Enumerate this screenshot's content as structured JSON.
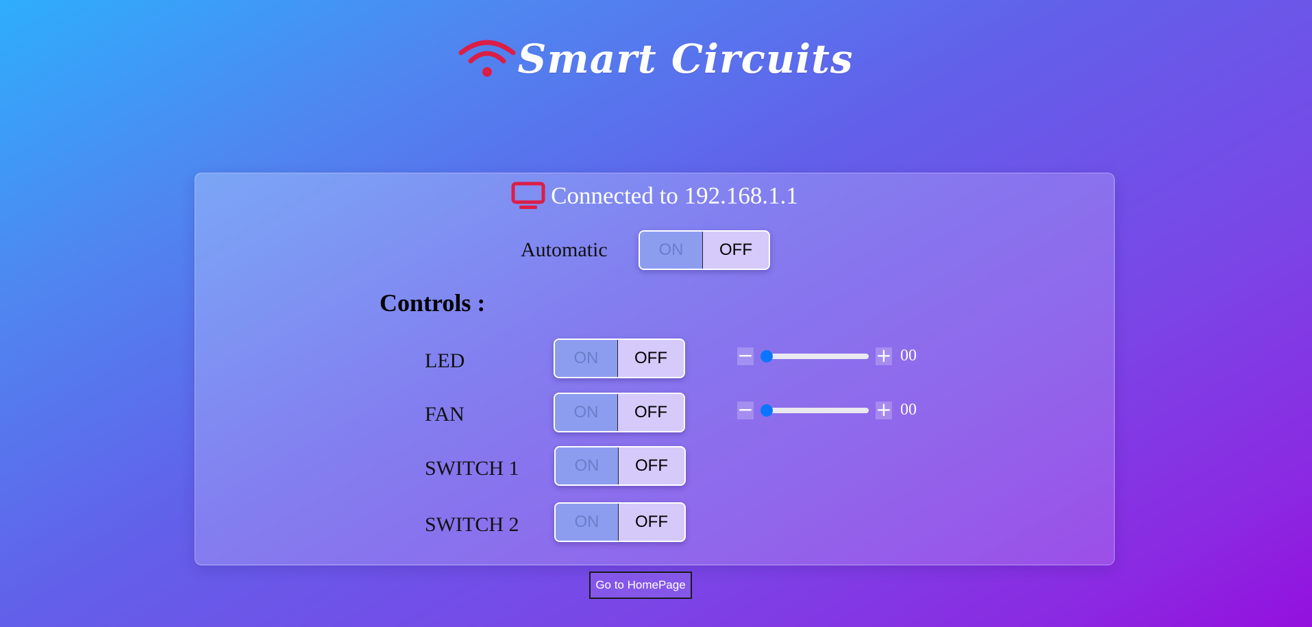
{
  "header": {
    "brand": "Smart Circuits",
    "icon": "wifi-icon"
  },
  "connection": {
    "text": "Connected to 192.168.1.1",
    "icon": "monitor-icon"
  },
  "automatic": {
    "label": "Automatic",
    "on_label": "ON",
    "off_label": "OFF",
    "state": "OFF"
  },
  "controls": {
    "title": "Controls :",
    "items": [
      {
        "label": "LED",
        "on_label": "ON",
        "off_label": "OFF",
        "state": "OFF",
        "slider_value": "00"
      },
      {
        "label": "FAN",
        "on_label": "ON",
        "off_label": "OFF",
        "state": "OFF",
        "slider_value": "00"
      },
      {
        "label": "SWITCH 1",
        "on_label": "ON",
        "off_label": "OFF",
        "state": "OFF"
      },
      {
        "label": "SWITCH 2",
        "on_label": "ON",
        "off_label": "OFF",
        "state": "OFF"
      }
    ]
  },
  "slider_controls": {
    "minus": "−",
    "plus": "+"
  },
  "home_button": "Go to HomePage",
  "colors": {
    "accent_red": "#dc1e46",
    "slider_blue": "#0a76ff"
  }
}
